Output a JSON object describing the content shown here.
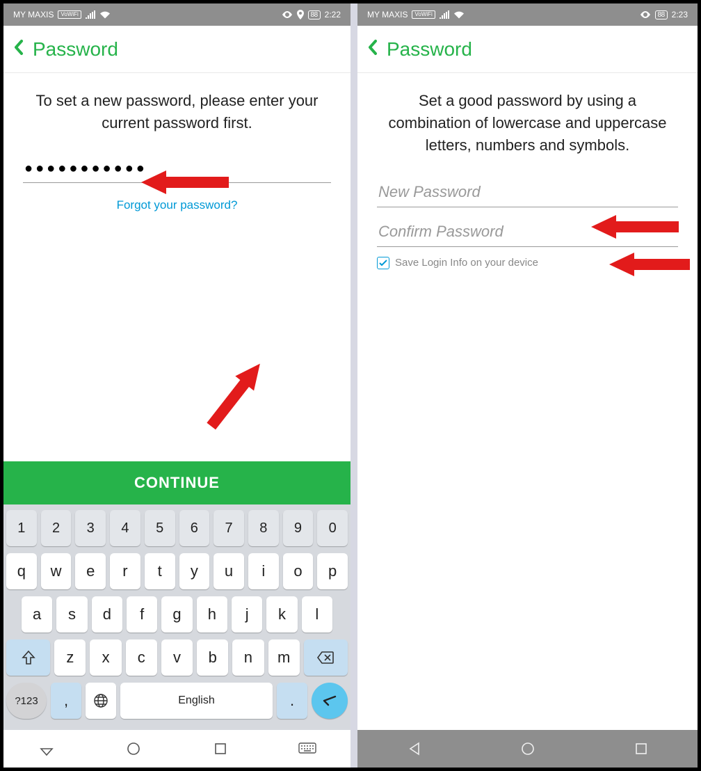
{
  "left": {
    "status": {
      "carrier": "MY MAXIS",
      "volte": "VoWiFi",
      "battery": "88",
      "time": "2:22"
    },
    "header": {
      "title": "Password"
    },
    "instruction": "To set a new password, please enter your current password first.",
    "password_mask": "●●●●●●●●●●●",
    "forgot": "Forgot your password?",
    "continue": "CONTINUE",
    "keyboard": {
      "row_num": [
        "1",
        "2",
        "3",
        "4",
        "5",
        "6",
        "7",
        "8",
        "9",
        "0"
      ],
      "row_q": [
        "q",
        "w",
        "e",
        "r",
        "t",
        "y",
        "u",
        "i",
        "o",
        "p"
      ],
      "row_a": [
        "a",
        "s",
        "d",
        "f",
        "g",
        "h",
        "j",
        "k",
        "l"
      ],
      "row_z": [
        "z",
        "x",
        "c",
        "v",
        "b",
        "n",
        "m"
      ],
      "sym": "?123",
      "comma": ",",
      "space": "English",
      "period": "."
    }
  },
  "right": {
    "status": {
      "carrier": "MY MAXIS",
      "volte": "VoWiFi",
      "battery": "88",
      "time": "2:23"
    },
    "header": {
      "title": "Password"
    },
    "instruction": "Set a good password by using a combination of lowercase and uppercase letters, numbers and symbols.",
    "new_pwd_placeholder": "New Password",
    "confirm_pwd_placeholder": "Confirm Password",
    "save_login_label": "Save Login Info on your device",
    "save_login_checked": true
  }
}
